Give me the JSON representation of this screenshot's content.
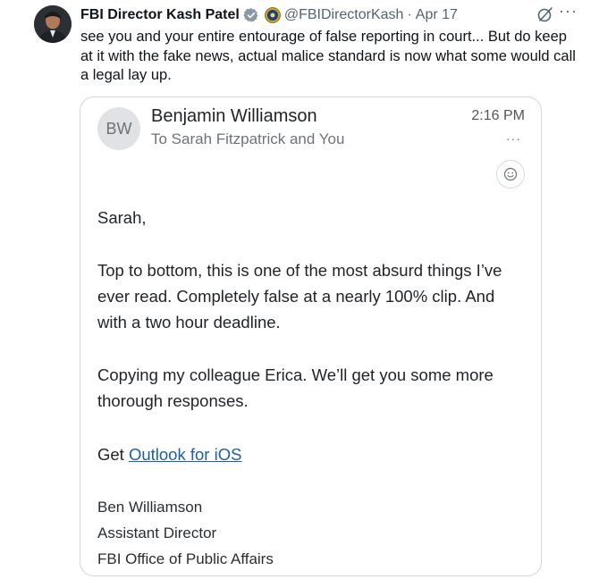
{
  "tweet": {
    "author_name": "FBI Director Kash Patel",
    "handle": "@FBIDirectorKash",
    "separator": "·",
    "date": "Apr 17",
    "more_label": "···",
    "text": "see you and your entire entourage of false reporting in court... But do keep at it with the fake news, actual malice standard is now what some would call a legal lay up."
  },
  "email": {
    "avatar_initials": "BW",
    "sender": "Benjamin Williamson",
    "recipients": "To Sarah Fitzpatrick and You",
    "time": "2:16 PM",
    "more_label": "···",
    "greeting": "Sarah,",
    "paragraph1": "Top to bottom, this is one of the most absurd things I’ve ever read. Completely false at a nearly 100% clip. And with a two hour deadline.",
    "paragraph2": "Copying my colleague Erica. We’ll get you some more thorough responses.",
    "get_prefix": "Get ",
    "get_link": "Outlook for iOS",
    "signature": [
      "Ben Williamson",
      "Assistant Director",
      "FBI Office of Public Affairs"
    ]
  },
  "colors": {
    "verified_badge": "#1d9bf0",
    "link": "#1d5fa8",
    "muted_text": "#536471"
  },
  "icons": [
    "verified-badge-icon",
    "agency-seal-icon",
    "grok-icon",
    "more-icon",
    "emoji-reaction-icon"
  ]
}
